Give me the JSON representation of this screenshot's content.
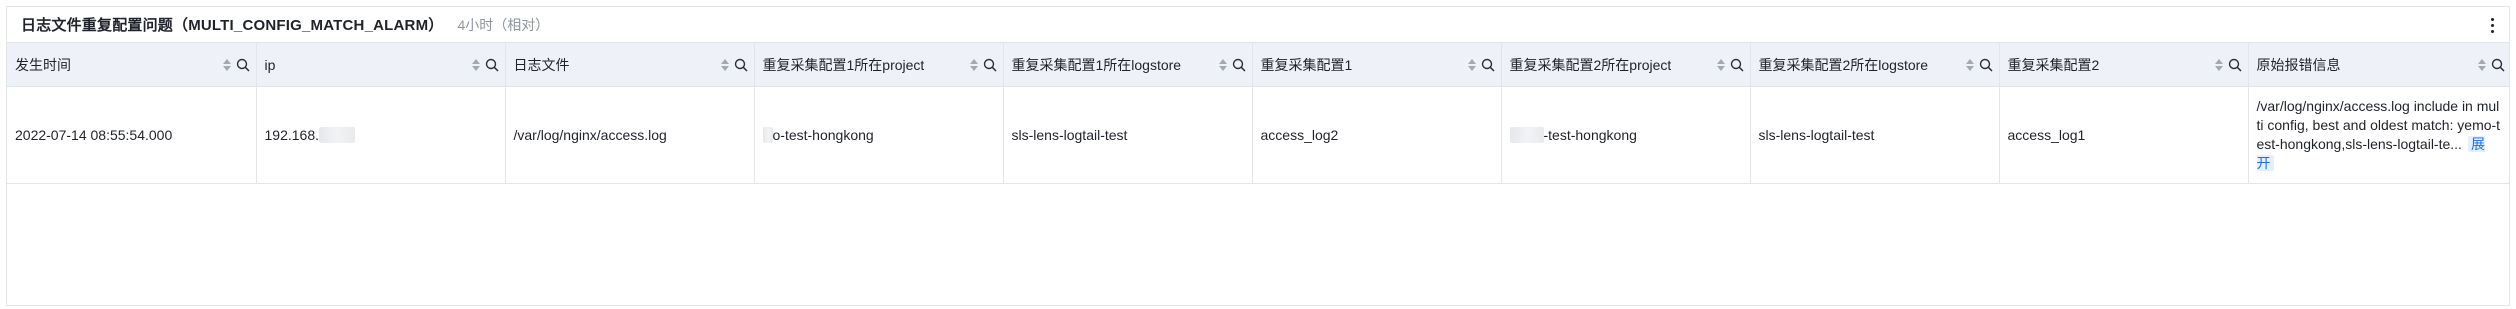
{
  "panel": {
    "title": "日志文件重复配置问题（MULTI_CONFIG_MATCH_ALARM）",
    "time_range": "4小时（相对）",
    "more_icon": "more-vertical-icon"
  },
  "table": {
    "columns": [
      {
        "label": "发生时间"
      },
      {
        "label": "ip"
      },
      {
        "label": "日志文件"
      },
      {
        "label": "重复采集配置1所在project"
      },
      {
        "label": "重复采集配置1所在logstore"
      },
      {
        "label": "重复采集配置1"
      },
      {
        "label": "重复采集配置2所在project"
      },
      {
        "label": "重复采集配置2所在logstore"
      },
      {
        "label": "重复采集配置2"
      },
      {
        "label": "原始报错信息"
      }
    ],
    "rows": [
      {
        "time": "2022-07-14 08:55:54.000",
        "ip": "192.168.",
        "log_file": "/var/log/nginx/access.log",
        "project1": "o-test-hongkong",
        "logstore1": "sls-lens-logtail-test",
        "config1": "access_log2",
        "project2": "-test-hongkong",
        "logstore2": "sls-lens-logtail-test",
        "config2": "access_log1",
        "raw_error": "/var/log/nginx/access.log include in multi config, best and oldest match: yemo-test-hongkong,sls-lens-logtail-te...",
        "expand_label": "展开"
      }
    ]
  },
  "colors": {
    "header_bg": "#eef2f8",
    "border": "#e3e5e8",
    "link": "#1f6fd6"
  }
}
